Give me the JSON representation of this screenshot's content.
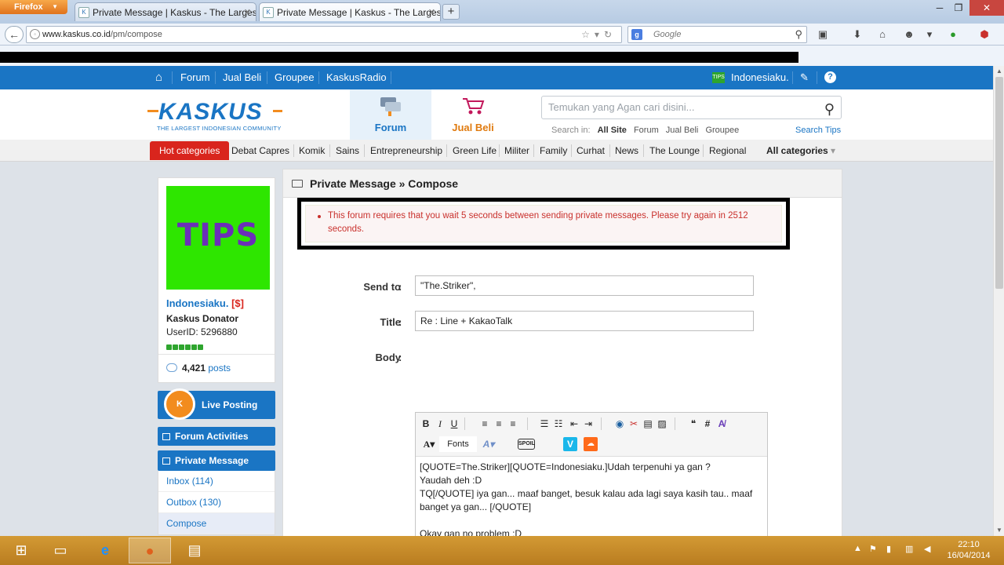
{
  "browser": {
    "menu_button": "Firefox",
    "tabs": [
      {
        "title": "Private Message | Kaskus - The Larges..."
      },
      {
        "title": "Private Message | Kaskus - The Larges..."
      }
    ],
    "url_domain": "www.kaskus.co.id",
    "url_path": "/pm/compose",
    "search_engine": "Google",
    "search_placeholder": "Google"
  },
  "site": {
    "topnav": [
      "Forum",
      "Jual Beli",
      "Groupee",
      "KaskusRadio"
    ],
    "user_short": "Indonesiaku.",
    "logo": {
      "word": "KASKUS",
      "tagline": "THE LARGEST INDONESIAN COMMUNITY"
    },
    "header_tabs": [
      "Forum",
      "Jual Beli"
    ],
    "search": {
      "placeholder": "Temukan yang Agan cari disini...",
      "in_label": "Search in:",
      "options": [
        "All Site",
        "Forum",
        "Jual Beli",
        "Groupee"
      ],
      "tips": "Search Tips"
    },
    "categories": {
      "hot": "Hot categories",
      "items": [
        "Debat Capres",
        "Komik",
        "Sains",
        "Entrepreneurship",
        "Green Life",
        "Militer",
        "Family",
        "Curhat",
        "News",
        "The Lounge",
        "Regional"
      ],
      "all": "All categories"
    }
  },
  "sidebar": {
    "avatar_text": "TIPS",
    "username": "Indonesiaku.",
    "username_tag": "[$]",
    "role": "Kaskus Donator",
    "userid": "UserID: 5296880",
    "posts_count": "4,421",
    "posts_label": "posts",
    "live_posting": "Live Posting",
    "forum_activities": "Forum Activities",
    "private_message": "Private Message",
    "pm_items": [
      "Inbox (114)",
      "Outbox (130)",
      "Compose"
    ]
  },
  "compose": {
    "heading": "Private Message » Compose",
    "error": "This forum requires that you wait 5 seconds between sending private messages. Please try again in 2512 seconds.",
    "send_to_label": "Send to",
    "send_to_value": "\"The.Striker\",",
    "title_label": "Title",
    "title_value": "Re : Line + KakaoTalk",
    "body_label": "Body",
    "toolbar": {
      "fonts": "Fonts"
    },
    "body_lines": [
      "[QUOTE=The.Striker][QUOTE=Indonesiaku.]Udah terpenuhi ya gan ?",
      "Yaudah deh :D",
      "TQ[/QUOTE] iya gan... maaf banget, besuk kalau ada lagi saya kasih tau.. maaf banget ya gan... [/QUOTE]",
      "",
      "Okay gan no problem :D"
    ]
  },
  "taskbar": {
    "time": "22:10",
    "date": "16/04/2014"
  }
}
